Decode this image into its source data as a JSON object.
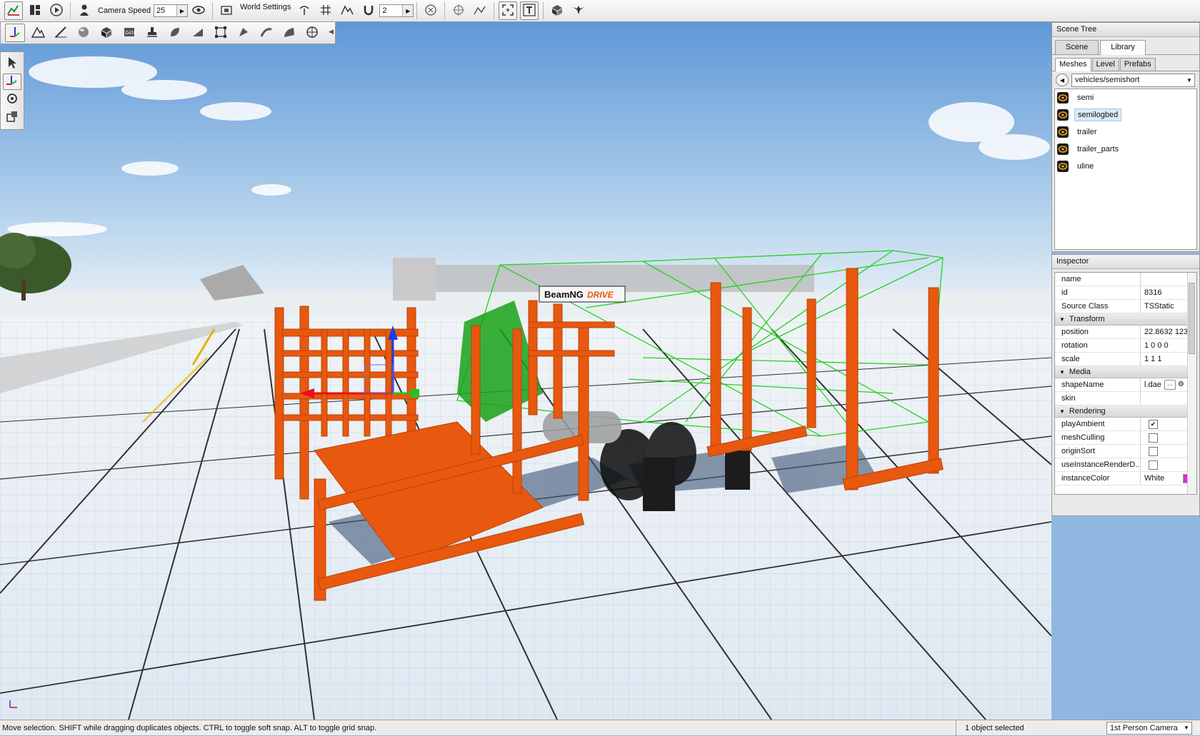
{
  "toolbar": {
    "camera_speed_label": "Camera Speed",
    "camera_speed_value": "25",
    "world_settings_label": "World Settings",
    "snap_value": "2"
  },
  "scene_tree": {
    "title": "Scene Tree",
    "tabs": [
      {
        "label": "Scene"
      },
      {
        "label": "Library"
      }
    ],
    "subtabs": [
      {
        "label": "Meshes"
      },
      {
        "label": "Level"
      },
      {
        "label": "Prefabs"
      }
    ],
    "path": "vehicles/semishort",
    "meshes": [
      {
        "label": "semi"
      },
      {
        "label": "semilogbed"
      },
      {
        "label": "trailer"
      },
      {
        "label": "trailer_parts"
      },
      {
        "label": "uline"
      }
    ],
    "selected_mesh": "semilogbed"
  },
  "inspector": {
    "title": "Inspector",
    "fields": {
      "name": {
        "key": "name",
        "value": ""
      },
      "id": {
        "key": "id",
        "value": "8316"
      },
      "source_class": {
        "key": "Source Class",
        "value": "TSStatic"
      }
    },
    "groups": {
      "transform": "Transform",
      "media": "Media",
      "rendering": "Rendering"
    },
    "transform": {
      "position": {
        "key": "position",
        "value": "22.8632 123"
      },
      "rotation": {
        "key": "rotation",
        "value": "1 0 0 0"
      },
      "scale": {
        "key": "scale",
        "value": "1 1 1"
      }
    },
    "media": {
      "shape_name": {
        "key": "shapeName",
        "value": "l.dae"
      },
      "skin": {
        "key": "skin",
        "value": ""
      }
    },
    "rendering": {
      "play_ambient": {
        "key": "playAmbient",
        "checked": true
      },
      "mesh_culling": {
        "key": "meshCulling",
        "checked": false
      },
      "origin_sort": {
        "key": "originSort",
        "checked": false
      },
      "use_instance": {
        "key": "useInstanceRenderD...",
        "checked": false
      },
      "instance_color": {
        "key": "instanceColor",
        "value": "White",
        "swatch": "#e12ad8"
      }
    }
  },
  "viewport": {
    "billboard_text": "BeamNG",
    "billboard_accent": "DRIVE"
  },
  "status": {
    "message": "Move selection.  SHIFT while dragging duplicates objects.  CTRL to toggle soft snap.  ALT to toggle grid snap.",
    "selection": "1 object selected",
    "camera": "1st Person Camera"
  },
  "colors": {
    "accent_orange": "#e8580e",
    "wire_green": "#22d11e",
    "sky": "#8fb7e0"
  }
}
